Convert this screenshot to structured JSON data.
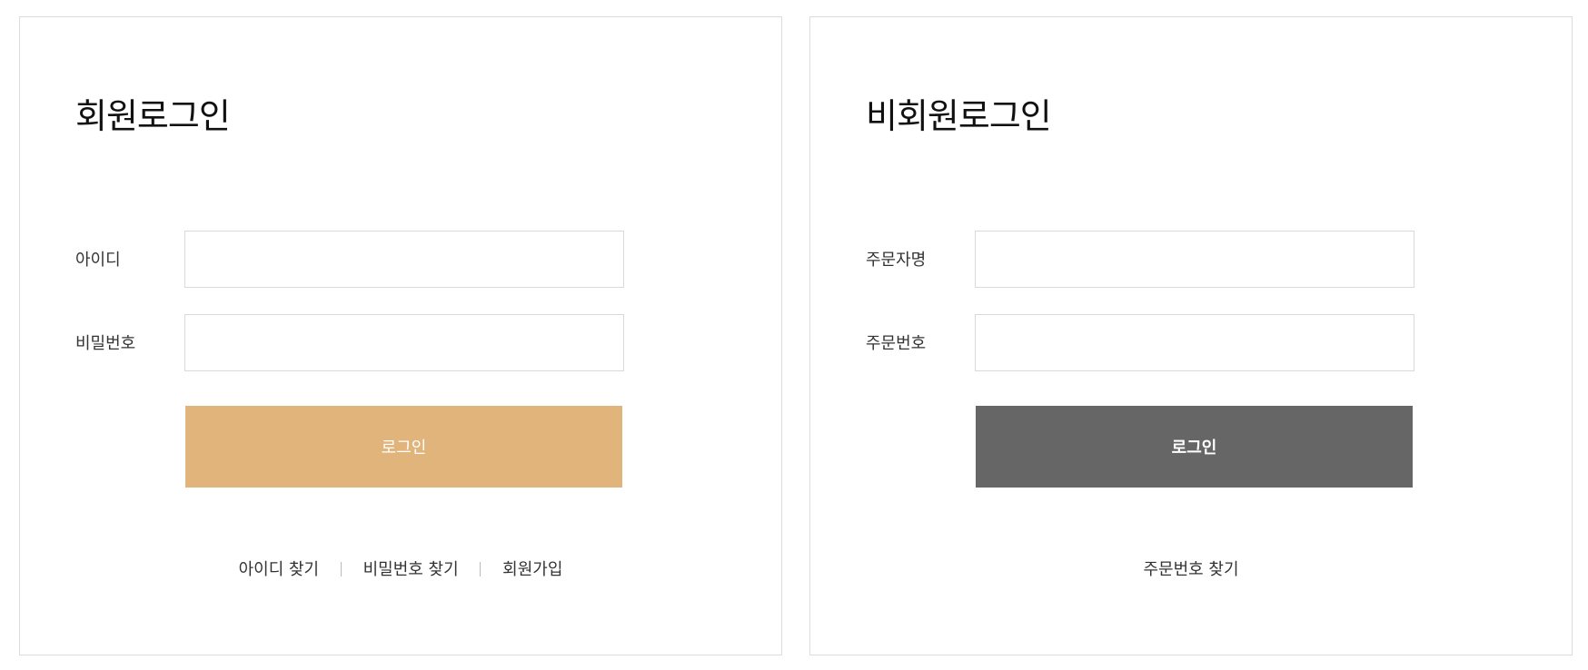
{
  "member": {
    "title": "회원로그인",
    "id_label": "아이디",
    "id_value": "",
    "password_label": "비밀번호",
    "password_value": "",
    "login_button": "로그인",
    "links": {
      "find_id": "아이디 찾기",
      "find_password": "비밀번호 찾기",
      "signup": "회원가입"
    }
  },
  "guest": {
    "title": "비회원로그인",
    "orderer_label": "주문자명",
    "orderer_value": "",
    "order_number_label": "주문번호",
    "order_number_value": "",
    "login_button": "로그인",
    "links": {
      "find_order_number": "주문번호 찾기"
    }
  },
  "colors": {
    "member_button": "#e1b47b",
    "guest_button": "#666666",
    "panel_border": "#dcdcdc"
  }
}
